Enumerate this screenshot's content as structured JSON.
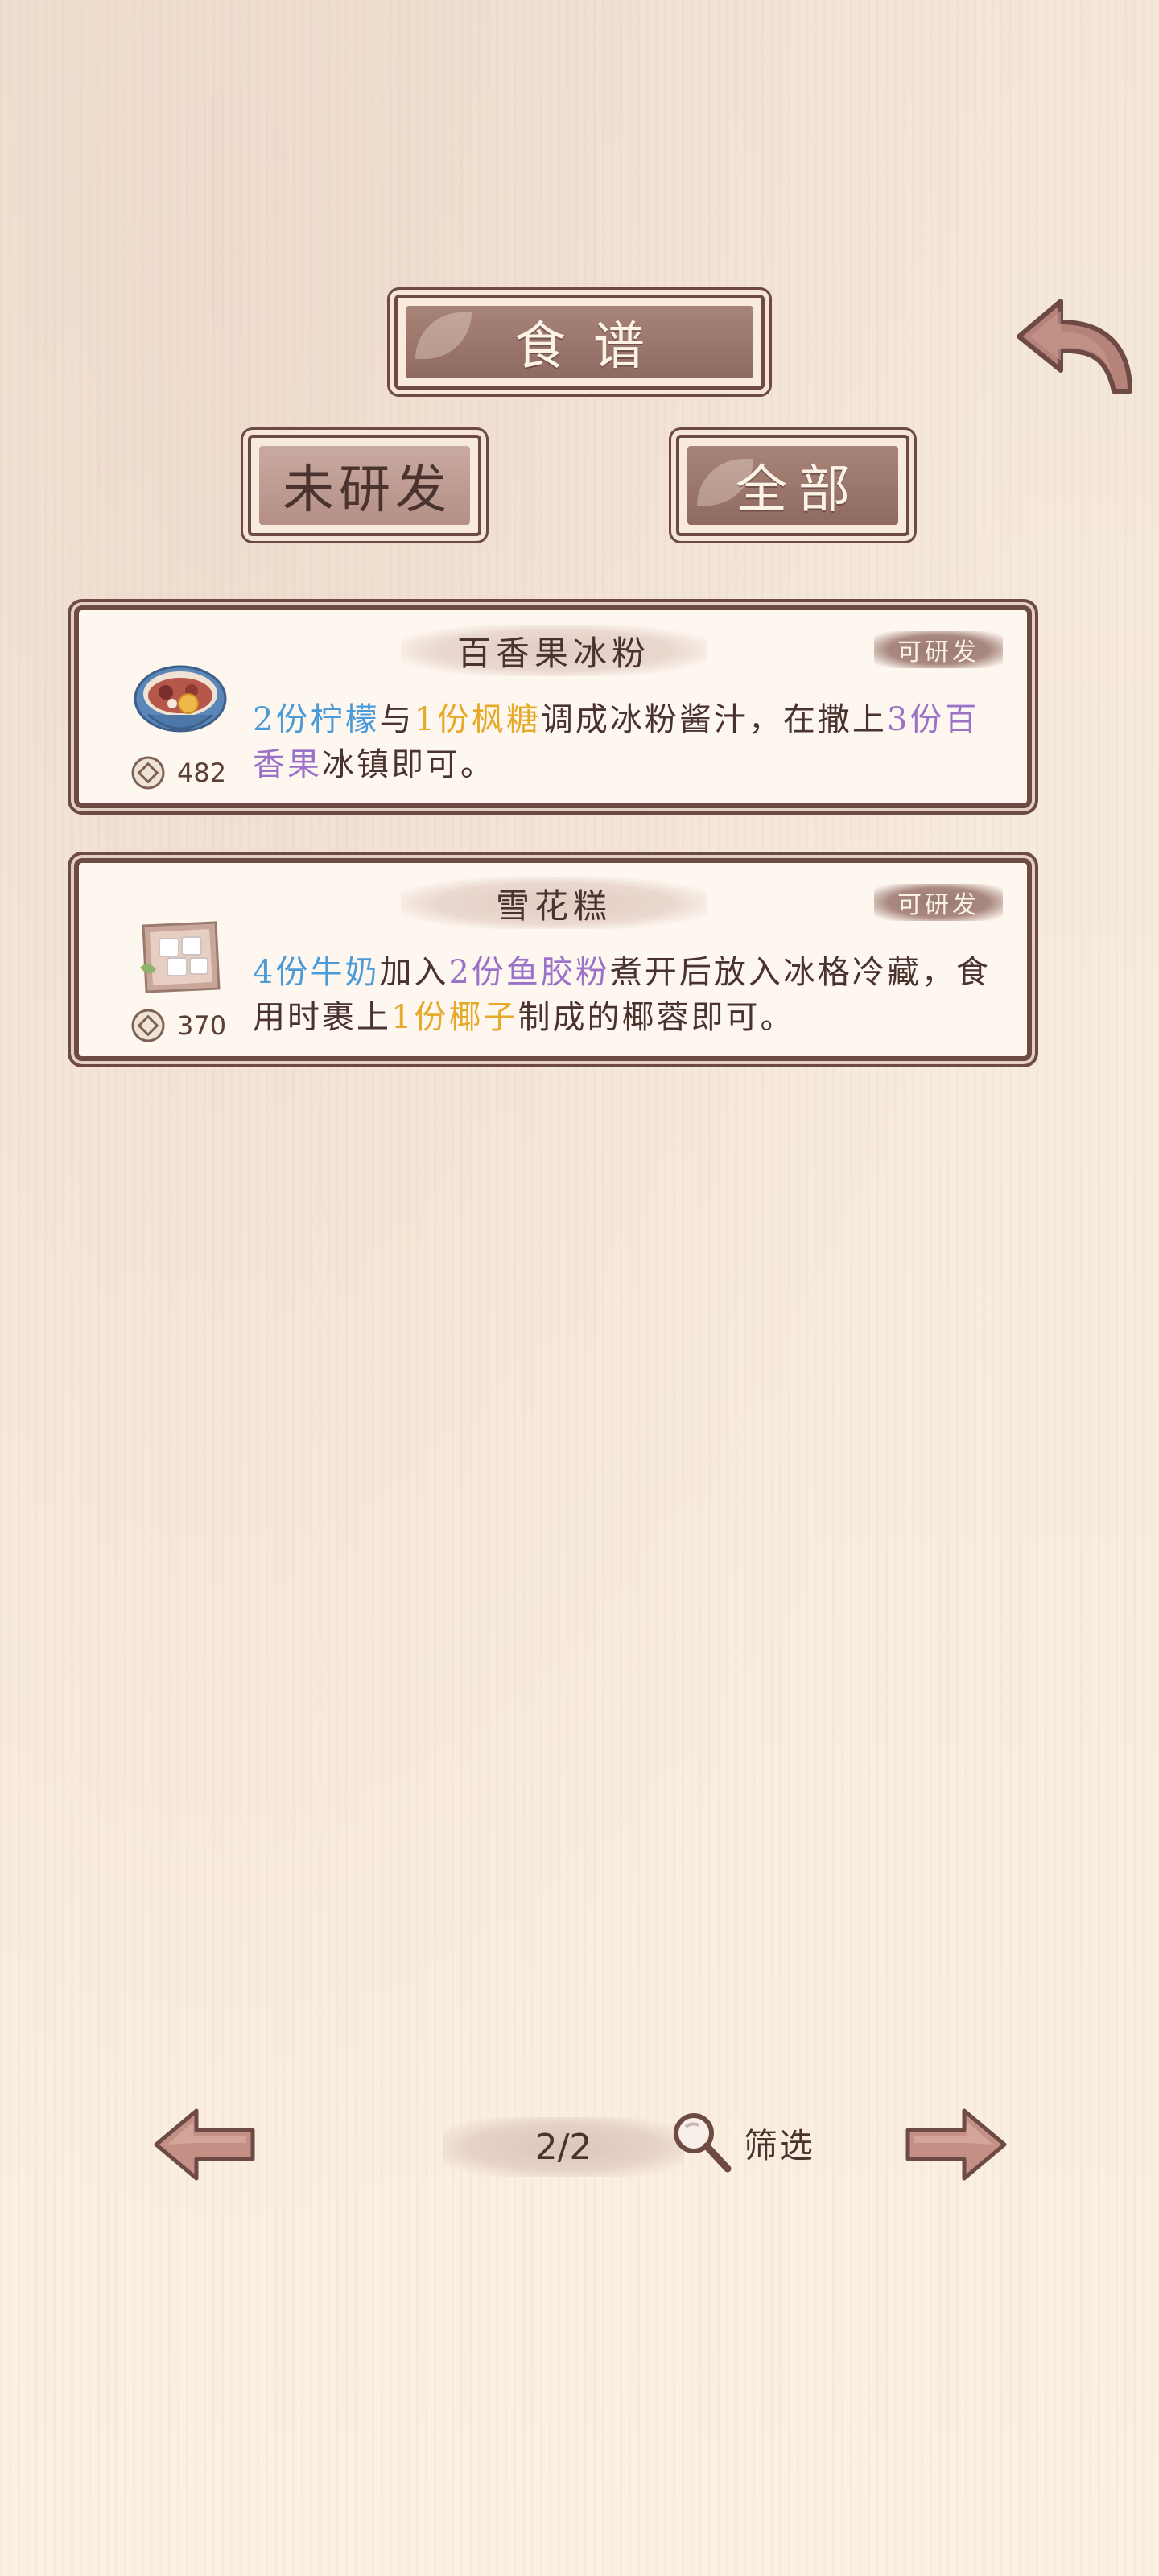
{
  "header": {
    "title": "食谱",
    "tabs": [
      {
        "label": "未研发",
        "active": false
      },
      {
        "label": "全部",
        "active": true
      }
    ]
  },
  "recipes": [
    {
      "name": "百香果冰粉",
      "badge": "可研发",
      "price": "482",
      "icon": "ice-jelly-bowl-icon",
      "desc_parts": [
        {
          "text": "2份柠檬",
          "color": "blue"
        },
        {
          "text": "与",
          "color": "plain"
        },
        {
          "text": "1份枫糖",
          "color": "gold"
        },
        {
          "text": "调成冰粉酱汁，在撒上",
          "color": "plain"
        },
        {
          "text": "3份百香果",
          "color": "purple"
        },
        {
          "text": "冰镇即可。",
          "color": "plain"
        }
      ]
    },
    {
      "name": "雪花糕",
      "badge": "可研发",
      "price": "370",
      "icon": "snowflake-cake-icon",
      "desc_parts": [
        {
          "text": "4份牛奶",
          "color": "blue"
        },
        {
          "text": "加入",
          "color": "plain"
        },
        {
          "text": "2份鱼胶粉",
          "color": "purple"
        },
        {
          "text": "煮开后放入冰格冷藏，食用时裹上",
          "color": "plain"
        },
        {
          "text": "1份椰子",
          "color": "gold"
        },
        {
          "text": "制成的椰蓉即可。",
          "color": "plain"
        }
      ]
    }
  ],
  "pager": {
    "text": "2/2"
  },
  "filter": {
    "label": "筛选"
  },
  "colors": {
    "frame": "#6e4a45",
    "blue": "#4a9bd8",
    "gold": "#e5aa2a",
    "purple": "#9a72c8",
    "paper": "#fdf7ef"
  }
}
